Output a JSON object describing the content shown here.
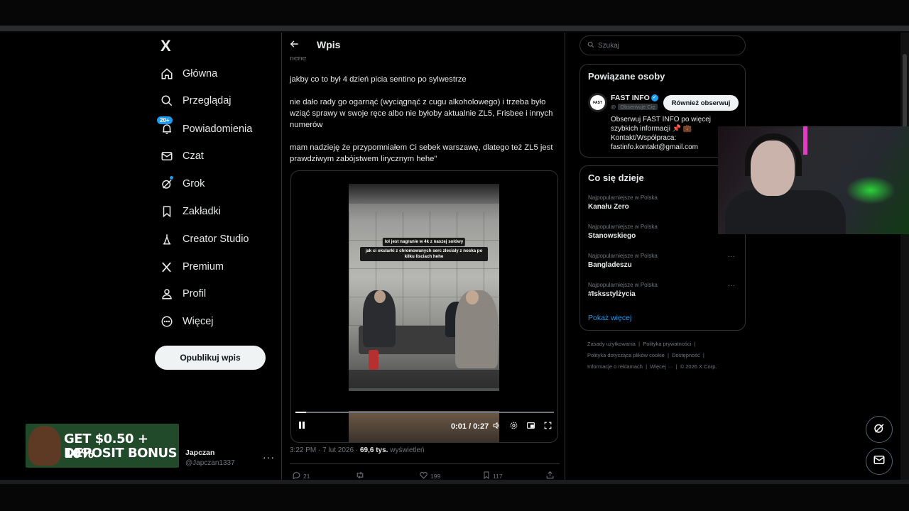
{
  "nav": {
    "logo": "X",
    "items": [
      {
        "label": "Główna",
        "icon": "home-icon"
      },
      {
        "label": "Przeglądaj",
        "icon": "search-icon"
      },
      {
        "label": "Powiadomienia",
        "icon": "bell-icon",
        "badge": "20+"
      },
      {
        "label": "Czat",
        "icon": "mail-icon"
      },
      {
        "label": "Grok",
        "icon": "grok-icon"
      },
      {
        "label": "Zakładki",
        "icon": "bookmark-icon"
      },
      {
        "label": "Creator Studio",
        "icon": "creator-icon"
      },
      {
        "label": "Premium",
        "icon": "x-icon"
      },
      {
        "label": "Profil",
        "icon": "profile-icon"
      },
      {
        "label": "Więcej",
        "icon": "more-circle-icon"
      }
    ],
    "publish_label": "Opublikuj wpis",
    "user": {
      "name": "Japczan",
      "handle": "@Japczan1337",
      "more": "···"
    }
  },
  "post": {
    "header_title": "Wpis",
    "clipped_text": "hehe",
    "paragraphs": [
      "jakby co to był 4 dzień picia sentino po sylwestrze",
      "nie dało rady go ogarnąć (wyciągnąć z cugu alkoholowego) i trzeba było wziąć sprawy w swoje ręce albo nie byłoby aktualnie ZL5, Frisbee i innych numerów",
      "mam nadzieję że przypomniałem Ci sebek warszawę, dlatego też ZL5 jest prawdziwym zabójstwem lirycznym hehe\""
    ],
    "video": {
      "caption_1": "lol jest nagranie w 4k z naszej solówy",
      "caption_2": "jak ci okularki z chromowanych serc zlecialy z noska po kilku lisciach hehe",
      "time": "0:01 / 0:27",
      "progress": 0.04
    },
    "timestamp": "3:22 PM · 7 lut 2026 · ",
    "views_count": "69,6 tys.",
    "views_label": " wyświetleń",
    "actions": [
      {
        "icon": "reply-icon",
        "count": "21"
      },
      {
        "icon": "repost-icon",
        "count": ""
      },
      {
        "icon": "like-icon",
        "count": "199"
      },
      {
        "icon": "bookmark-icon",
        "count": "117"
      },
      {
        "icon": "share-icon",
        "count": ""
      }
    ]
  },
  "sidebar": {
    "search_placeholder": "Szukaj",
    "related": {
      "title": "Powiązane osoby",
      "name": "FAST INFO",
      "handle": "@",
      "follows_you": "Obserwuje Cię",
      "follow_label": "Również obserwuj",
      "bio_1": "Obserwuj FAST INFO po więcej szybkich informacji 📌 💼",
      "bio_2": "Kontakt/Współpraca: fastinfo.kontakt@gmail.com",
      "avatar_text": "FAST"
    },
    "trends": {
      "title": "Co się dzieje",
      "items": [
        {
          "category": "Najpopularniejsze w Polska",
          "name": "Kanału Zero"
        },
        {
          "category": "Najpopularniejsze w Polska",
          "name": "Stanowskiego"
        },
        {
          "category": "Najpopularniejsze w Polska",
          "name": "Bangladeszu"
        },
        {
          "category": "Najpopularniejsze w Polska",
          "name": "#Isksstylżycia"
        }
      ],
      "show_more": "Pokaż więcej"
    },
    "footer": {
      "terms": "Zasady użytkowania",
      "privacy": "Polityka prywatności",
      "cookies": "Polityka dotycząca plików cookie",
      "accessibility": "Dostępność",
      "ads": "Informacje o reklamach",
      "more": "Więcej ···",
      "copyright": "© 2026 X Corp."
    }
  },
  "overlay": {
    "promo_line1": "GET $0.50 + 10%",
    "promo_line2": "DEPOSIT BONUS"
  },
  "colors": {
    "accent": "#1d9bf0",
    "background": "#000000",
    "border": "#2f3336",
    "muted": "#71767b"
  }
}
